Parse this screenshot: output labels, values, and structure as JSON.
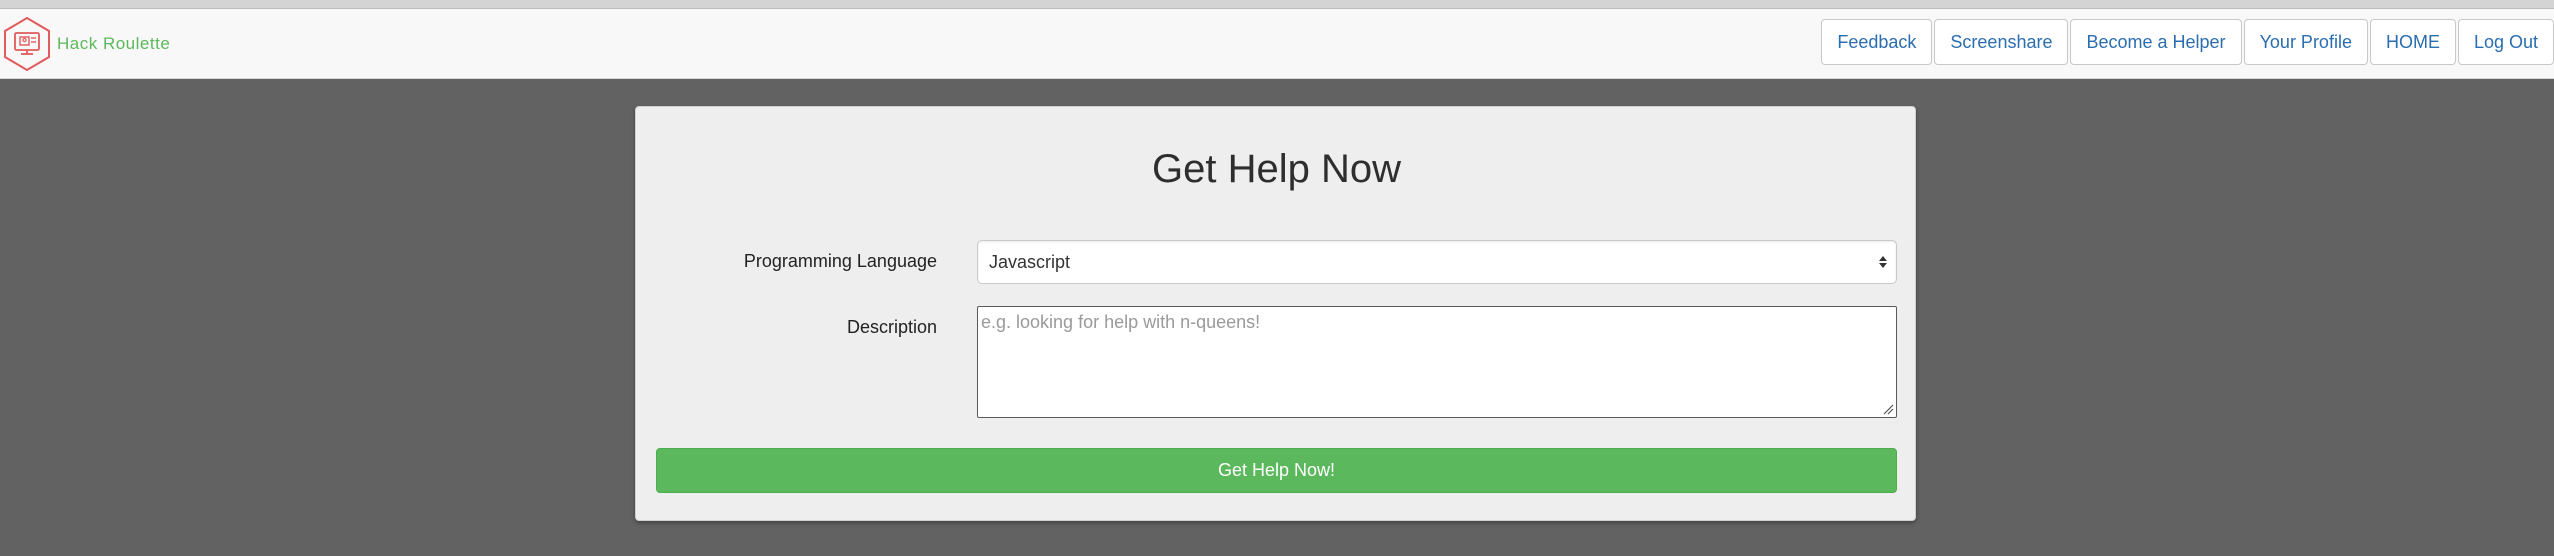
{
  "brand": {
    "name": "Hack Roulette",
    "logo_icon": "hexagon-computer-icon",
    "color": "#5cb85c",
    "logo_color": "#e05b5b"
  },
  "nav": {
    "items": [
      {
        "label": "Feedback"
      },
      {
        "label": "Screenshare"
      },
      {
        "label": "Become a Helper"
      },
      {
        "label": "Your Profile"
      },
      {
        "label": "HOME"
      },
      {
        "label": "Log Out"
      }
    ],
    "link_color": "#2a6db0"
  },
  "form": {
    "title": "Get Help Now",
    "language_label": "Programming Language",
    "language_value": "Javascript",
    "description_label": "Description",
    "description_value": "",
    "description_placeholder": "e.g. looking for help with n-queens!",
    "submit_label": "Get Help Now!",
    "submit_color": "#5cb85c"
  },
  "colors": {
    "page_background": "#626262",
    "panel_background": "#eeeeee"
  }
}
